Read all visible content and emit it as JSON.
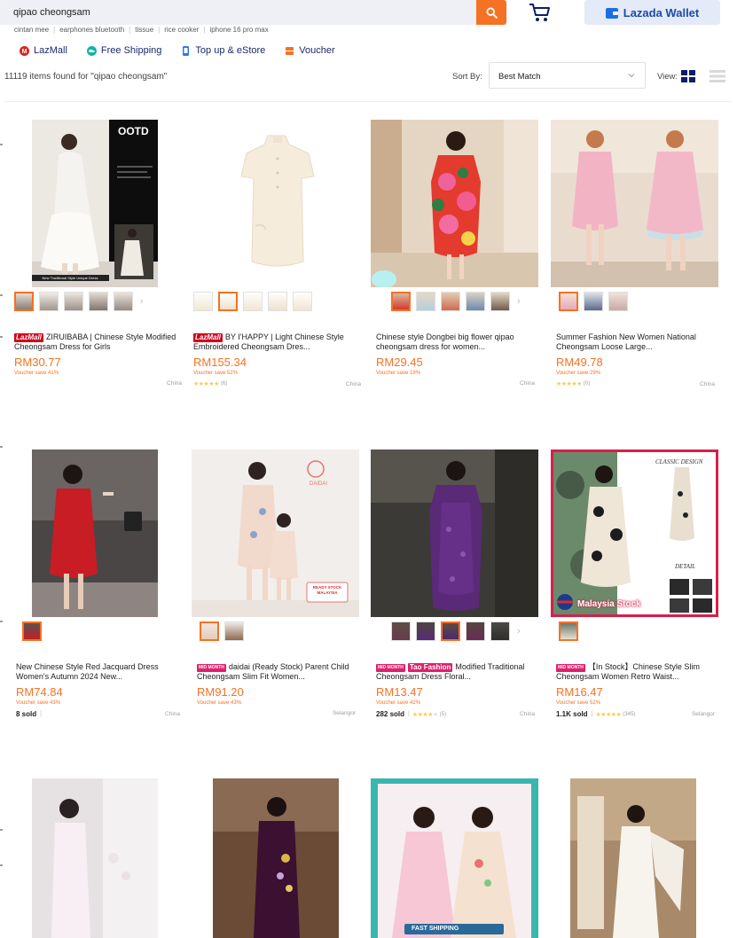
{
  "search": {
    "query": "qipao cheongsam"
  },
  "wallet_label": "Lazada Wallet",
  "suggestions": [
    "cintan mee",
    "earphones bluetooth",
    "tissue",
    "rice cooker",
    "iphone 16 pro max"
  ],
  "quick_links": [
    {
      "label": "LazMall",
      "color": "#e2231a"
    },
    {
      "label": "Free Shipping",
      "color": "#11b5a3"
    },
    {
      "label": "Top up & eStore",
      "color": "#2b78e4"
    },
    {
      "label": "Voucher",
      "color": "#f57224"
    }
  ],
  "results": {
    "count_text": "11119 items found for \"qipao cheongsam\"",
    "sort_label": "Sort By:",
    "sort_value": "Best Match",
    "view_label": "View:"
  },
  "products": [
    {
      "badges": [
        "LazMall"
      ],
      "title": "ZIRUIBABA | Chinese Style Modified Cheongsam Dress for Girls",
      "price": "RM30.77",
      "voucher": "Voucher save 41%",
      "sold": "",
      "stars": "",
      "reviews": "",
      "location": "China"
    },
    {
      "badges": [
        "LazMall"
      ],
      "title": "BY I'HAPPY | Light Chinese Style Embroidered Cheongsam Dres...",
      "price": "RM155.34",
      "voucher": "Voucher save 52%",
      "sold": "",
      "stars": "★★★★★",
      "reviews": "(6)",
      "location": "China"
    },
    {
      "badges": [],
      "title": "Chinese style Dongbei big flower qipao cheongsam dress for women...",
      "price": "RM29.45",
      "voucher": "Voucher save 19%",
      "sold": "",
      "stars": "",
      "reviews": "",
      "location": "China"
    },
    {
      "badges": [],
      "title": "Summer Fashion New Women National Cheongsam Loose Large...",
      "price": "RM49.78",
      "voucher": "Voucher save 29%",
      "sold": "",
      "stars": "★★★★★",
      "reviews": "(0)",
      "location": "China"
    },
    {
      "badges": [],
      "title": "New Chinese Style Red Jacquard Dress Women's Autumn 2024 New...",
      "price": "RM74.84",
      "voucher": "Voucher save 43%",
      "sold": "8 sold",
      "stars": "",
      "reviews": "",
      "location": "China"
    },
    {
      "badges": [
        "MID MONTH"
      ],
      "title": "daidai (Ready Stock) Parent Child Cheongsam Slim Fit Women...",
      "price": "RM91.20",
      "voucher": "Voucher save 43%",
      "sold": "",
      "stars": "",
      "reviews": "",
      "location": "Selangor"
    },
    {
      "badges": [
        "MID MONTH",
        "Tao Fashion"
      ],
      "title": "Modified Traditional Cheongsam Dress Floral...",
      "price": "RM13.47",
      "voucher": "Voucher save 42%",
      "sold": "282 sold",
      "stars": "★★★★",
      "stars_off": "★",
      "reviews": "(5)",
      "location": "China"
    },
    {
      "badges": [
        "MID MONTH"
      ],
      "title": "【In Stock】Chinese Style Slim Cheongsam Women Retro Waist...",
      "price": "RM16.47",
      "voucher": "Voucher save 52%",
      "sold": "1.1K sold",
      "stars": "★★★★★",
      "reviews": "(345)",
      "location": "Selangor"
    }
  ],
  "image_text": {
    "ootd": "OOTD",
    "daidai": "DAIDAI",
    "ready_stock": "READY STOCK MALAYSIA",
    "classic": "CLASSIC DESIGN",
    "detail": "DETAIL",
    "malaysia_stock": "Malaysia Stock",
    "fast_shipping": "FAST SHIPPING"
  }
}
